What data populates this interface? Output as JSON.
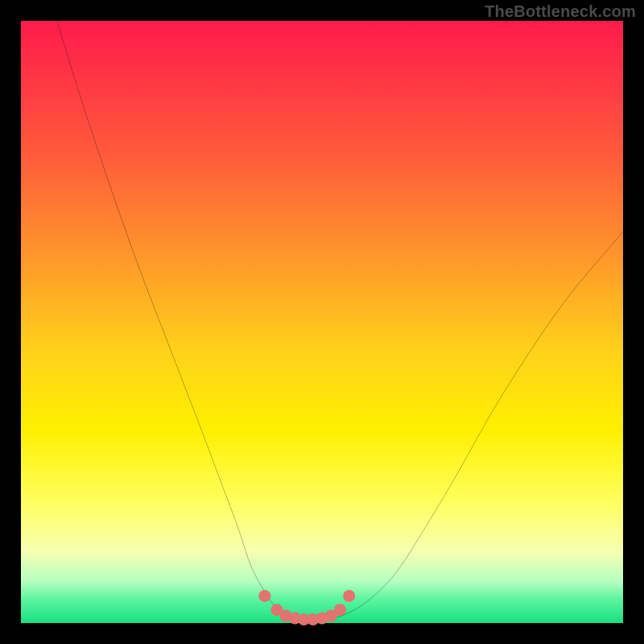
{
  "watermark": "TheBottleneck.com",
  "colors": {
    "frame": "#000000",
    "curve": "#000000",
    "marker": "#e2736f",
    "gradient_stops": [
      "#ff1a4b",
      "#ff5a3c",
      "#ff9a2a",
      "#ffd21a",
      "#fff000",
      "#ffff60",
      "#f7ffb0",
      "#b8ffc0",
      "#5df5a0",
      "#18e082"
    ]
  },
  "chart_data": {
    "type": "line",
    "title": "",
    "xlabel": "",
    "ylabel": "",
    "xlim": [
      0,
      100
    ],
    "ylim": [
      0,
      100
    ],
    "legend": false,
    "grid": false,
    "annotations": [],
    "series": [
      {
        "name": "curve",
        "x": [
          6,
          10,
          15,
          20,
          25,
          30,
          33,
          36,
          38,
          40,
          42,
          44,
          46,
          48,
          50,
          54,
          58,
          62,
          66,
          72,
          80,
          90,
          100
        ],
        "y": [
          100,
          87,
          72,
          58,
          45,
          32,
          24,
          16,
          10,
          6,
          3,
          1.2,
          0.4,
          0.1,
          0.4,
          1.5,
          4,
          8,
          14,
          24,
          38,
          53,
          65
        ]
      }
    ],
    "markers": {
      "name": "bottom-dots",
      "x": [
        40.5,
        42.5,
        44,
        45.5,
        47,
        48.5,
        50,
        51.5,
        53,
        54.5
      ],
      "y": [
        4.5,
        2.2,
        1.2,
        0.8,
        0.6,
        0.6,
        0.8,
        1.2,
        2.2,
        4.5
      ],
      "r": 1.0
    }
  }
}
